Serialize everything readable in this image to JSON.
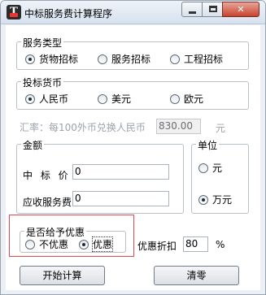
{
  "window": {
    "title": "中标服务费计算程序",
    "icon_text": "T"
  },
  "service_type": {
    "label": "服务类型",
    "options": [
      {
        "label": "货物招标",
        "checked": true
      },
      {
        "label": "服务招标",
        "checked": false
      },
      {
        "label": "工程招标",
        "checked": false
      }
    ]
  },
  "currency": {
    "label": "投标货币",
    "options": [
      {
        "label": "人民币",
        "checked": true
      },
      {
        "label": "美元",
        "checked": false
      },
      {
        "label": "欧元",
        "checked": false
      }
    ]
  },
  "exchange": {
    "label": "汇率：每100外币兑换人民币",
    "value": "830.00",
    "unit": "元"
  },
  "amount": {
    "label": "金额",
    "bid_price_label": "中 标 价",
    "bid_price_value": "0",
    "service_fee_label": "应收服务费",
    "service_fee_value": "0"
  },
  "unit": {
    "label": "单位",
    "options": [
      {
        "label": "元",
        "checked": false
      },
      {
        "label": "万元",
        "checked": true
      }
    ]
  },
  "discount": {
    "label": "是否给予优惠",
    "options": [
      {
        "label": "不优惠",
        "checked": false
      },
      {
        "label": "优惠",
        "checked": true
      }
    ],
    "rate_label": "优惠折扣",
    "rate_value": "80",
    "rate_unit": "%"
  },
  "buttons": {
    "start": "开始计算",
    "clear": "清零"
  },
  "colors": {
    "highlight": "#e04a4a",
    "titlebar": "#d6e1ee",
    "close_button": "#c7442e"
  }
}
